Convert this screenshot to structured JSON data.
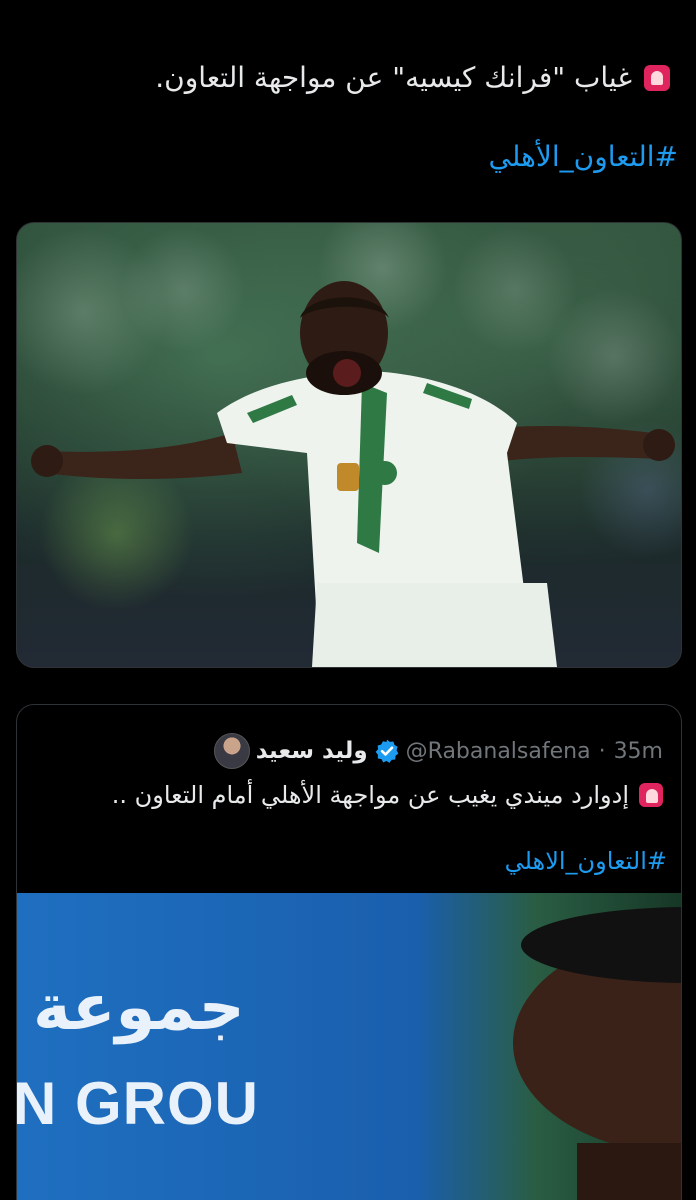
{
  "post": {
    "text": "غياب \"فرانك كيسيه\" عن مواجهة التعاون.",
    "hashtag": "#التعاون_الأهلي",
    "siren_icon": "police-car-light-icon"
  },
  "quote": {
    "name": "وليد سعيد",
    "handle": "@Rabanalsafena",
    "separator": "·",
    "time": "35m",
    "text": "إدوارد ميندي يغيب عن مواجهة الأهلي أمام التعاون ..",
    "hashtag": "#التعاون_الاهلي",
    "verified_icon": "verified-badge-icon",
    "colors": {
      "verified": "#1d9bf0"
    }
  },
  "media2": {
    "banner_line1": "جموعة",
    "banner_line2": "N GROU"
  },
  "colors": {
    "background": "#000000",
    "text": "#e7e9ea",
    "link": "#1d9bf0",
    "muted": "#71767b",
    "siren": "#e0245e"
  }
}
